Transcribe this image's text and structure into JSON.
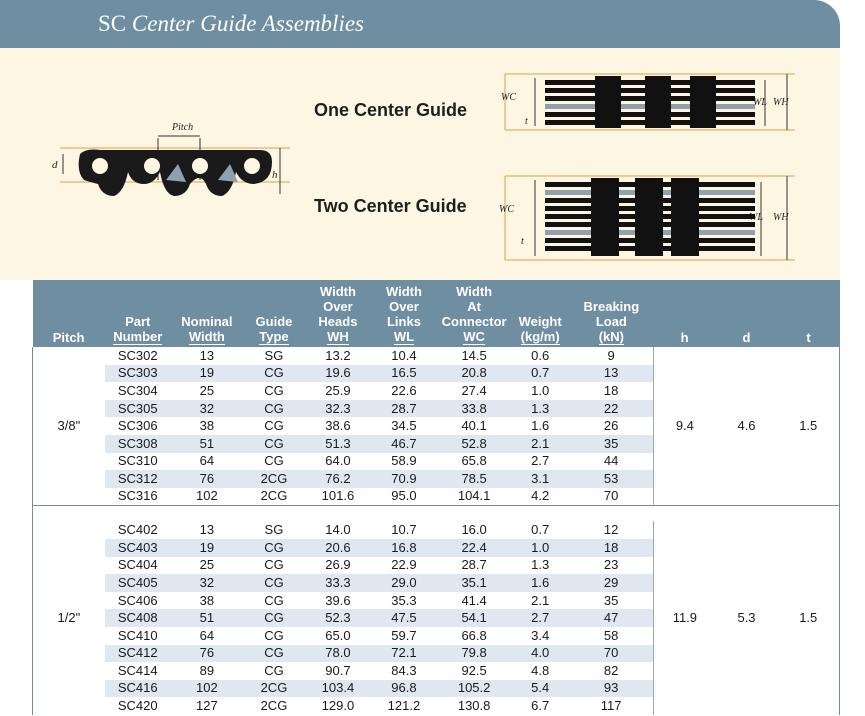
{
  "header": {
    "title_prefix": "SC",
    "title_italic": "Center Guide Assemblies"
  },
  "guides": {
    "one_label": "One Center Guide",
    "two_label": "Two Center Guide"
  },
  "diagram_labels": {
    "pitch": "Pitch",
    "d": "d",
    "h": "h",
    "wc": "WC",
    "wl": "WL",
    "wh": "WH",
    "t": "t"
  },
  "table": {
    "headers": {
      "pitch": [
        "Pitch"
      ],
      "part_number": [
        "Part",
        "Number"
      ],
      "nominal_width": [
        "Nominal",
        "Width"
      ],
      "guide_type": [
        "Guide",
        "Type"
      ],
      "wh": [
        "Width",
        "Over",
        "Heads",
        "WH"
      ],
      "wl": [
        "Width",
        "Over",
        "Links",
        "WL"
      ],
      "wc": [
        "Width",
        "At",
        "Connector",
        "WC"
      ],
      "weight": [
        "Weight",
        "(kg/m)"
      ],
      "breaking_load": [
        "Breaking",
        "Load",
        "(kN)"
      ],
      "h": [
        "h"
      ],
      "d": [
        "d"
      ],
      "t": [
        "t"
      ]
    },
    "groups": [
      {
        "pitch": "3/8\"",
        "h": "9.4",
        "d": "4.6",
        "t": "1.5",
        "rows": [
          [
            "SC302",
            "13",
            "SG",
            "13.2",
            "10.4",
            "14.5",
            "0.6",
            "9"
          ],
          [
            "SC303",
            "19",
            "CG",
            "19.6",
            "16.5",
            "20.8",
            "0.7",
            "13"
          ],
          [
            "SC304",
            "25",
            "CG",
            "25.9",
            "22.6",
            "27.4",
            "1.0",
            "18"
          ],
          [
            "SC305",
            "32",
            "CG",
            "32.3",
            "28.7",
            "33.8",
            "1.3",
            "22"
          ],
          [
            "SC306",
            "38",
            "CG",
            "38.6",
            "34.5",
            "40.1",
            "1.6",
            "26"
          ],
          [
            "SC308",
            "51",
            "CG",
            "51.3",
            "46.7",
            "52.8",
            "2.1",
            "35"
          ],
          [
            "SC310",
            "64",
            "CG",
            "64.0",
            "58.9",
            "65.8",
            "2.7",
            "44"
          ],
          [
            "SC312",
            "76",
            "2CG",
            "76.2",
            "70.9",
            "78.5",
            "3.1",
            "53"
          ],
          [
            "SC316",
            "102",
            "2CG",
            "101.6",
            "95.0",
            "104.1",
            "4.2",
            "70"
          ]
        ]
      },
      {
        "pitch": "1/2\"",
        "h": "11.9",
        "d": "5.3",
        "t": "1.5",
        "rows": [
          [
            "SC402",
            "13",
            "SG",
            "14.0",
            "10.7",
            "16.0",
            "0.7",
            "12"
          ],
          [
            "SC403",
            "19",
            "CG",
            "20.6",
            "16.8",
            "22.4",
            "1.0",
            "18"
          ],
          [
            "SC404",
            "25",
            "CG",
            "26.9",
            "22.9",
            "28.7",
            "1.3",
            "23"
          ],
          [
            "SC405",
            "32",
            "CG",
            "33.3",
            "29.0",
            "35.1",
            "1.6",
            "29"
          ],
          [
            "SC406",
            "38",
            "CG",
            "39.6",
            "35.3",
            "41.4",
            "2.1",
            "35"
          ],
          [
            "SC408",
            "51",
            "CG",
            "52.3",
            "47.5",
            "54.1",
            "2.7",
            "47"
          ],
          [
            "SC410",
            "64",
            "CG",
            "65.0",
            "59.7",
            "66.8",
            "3.4",
            "58"
          ],
          [
            "SC412",
            "76",
            "CG",
            "78.0",
            "72.1",
            "79.8",
            "4.0",
            "70"
          ],
          [
            "SC414",
            "89",
            "CG",
            "90.7",
            "84.3",
            "92.5",
            "4.8",
            "82"
          ],
          [
            "SC416",
            "102",
            "2CG",
            "103.4",
            "96.8",
            "105.2",
            "5.4",
            "93"
          ],
          [
            "SC420",
            "127",
            "2CG",
            "129.0",
            "121.2",
            "130.8",
            "6.7",
            "117"
          ]
        ]
      }
    ]
  },
  "colors": {
    "header_band": "#6f8ea1",
    "diagram_bg": "#fdf6e3",
    "row_stripe": "#dfe7f1",
    "dimension_line": "#e0a040",
    "link_steel": "#8fa0ae"
  }
}
